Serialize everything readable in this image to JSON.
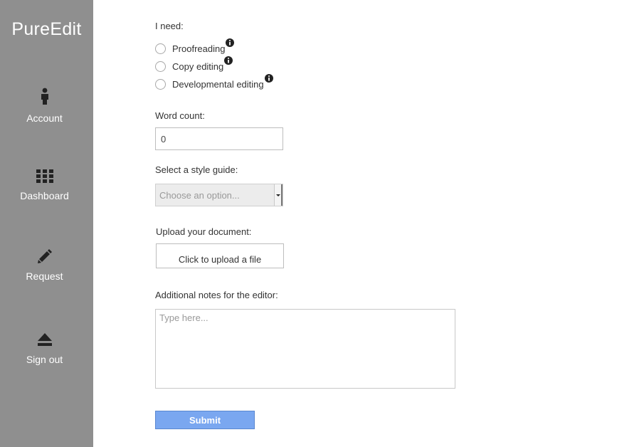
{
  "app": {
    "logo": "PureEdit"
  },
  "sidebar": {
    "items": [
      {
        "label": "Account",
        "icon": "person-icon"
      },
      {
        "label": "Dashboard",
        "icon": "grid-icon"
      },
      {
        "label": "Request",
        "icon": "pencil-icon"
      },
      {
        "label": "Sign out",
        "icon": "eject-icon"
      }
    ]
  },
  "form": {
    "need_label": "I need:",
    "options": [
      {
        "label": "Proofreading",
        "selected": false
      },
      {
        "label": "Copy editing",
        "selected": false
      },
      {
        "label": "Developmental editing",
        "selected": false
      }
    ],
    "word_count_label": "Word count:",
    "word_count_value": "0",
    "style_guide_label": "Select a style guide:",
    "style_guide_placeholder": "Choose an option...",
    "upload_label": "Upload your document:",
    "upload_button": "Click to upload a file",
    "notes_label": "Additional notes for the editor:",
    "notes_placeholder": "Type here...",
    "submit_label": "Submit"
  },
  "colors": {
    "sidebar": "#8f8f8f",
    "submit": "#7aa7f0"
  }
}
